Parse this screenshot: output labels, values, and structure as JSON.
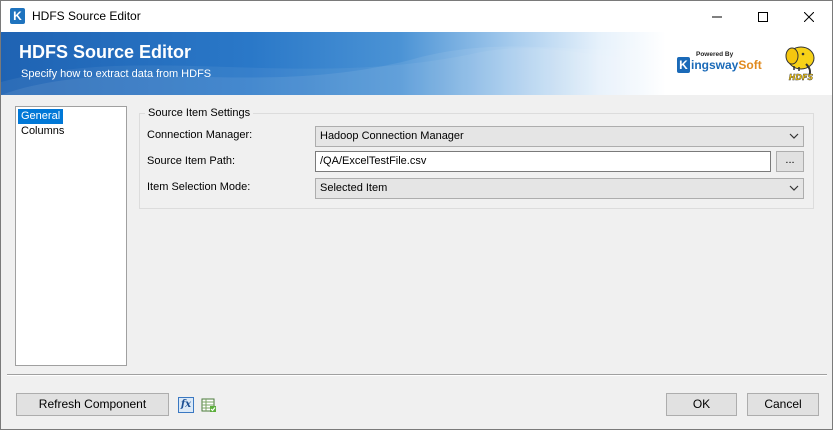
{
  "window": {
    "title": "HDFS Source Editor",
    "app_icon_letter": "K"
  },
  "banner": {
    "title": "HDFS Source Editor",
    "subtitle": "Specify how to extract data from HDFS",
    "logo": {
      "powered_by": "Powered By",
      "letter": "K",
      "brand_main": "ingsway",
      "brand_accent": "Soft"
    },
    "hdfs_logo_text": "HDFS"
  },
  "sidebar": {
    "items": [
      {
        "label": "General",
        "selected": true
      },
      {
        "label": "Columns",
        "selected": false
      }
    ]
  },
  "settings": {
    "group_label": "Source Item Settings",
    "connection_manager": {
      "label": "Connection Manager:",
      "value": "Hadoop Connection Manager"
    },
    "source_item_path": {
      "label": "Source Item Path:",
      "value": "/QA/ExcelTestFile.csv",
      "browse_label": "..."
    },
    "item_selection_mode": {
      "label": "Item Selection Mode:",
      "value": "Selected Item"
    }
  },
  "footer": {
    "refresh_label": "Refresh Component",
    "fx_label": "fx",
    "ok_label": "OK",
    "cancel_label": "Cancel"
  },
  "colors": {
    "accent": "#0078d7",
    "banner_blue": "#1f63b3",
    "brand_orange": "#e08a1e"
  }
}
